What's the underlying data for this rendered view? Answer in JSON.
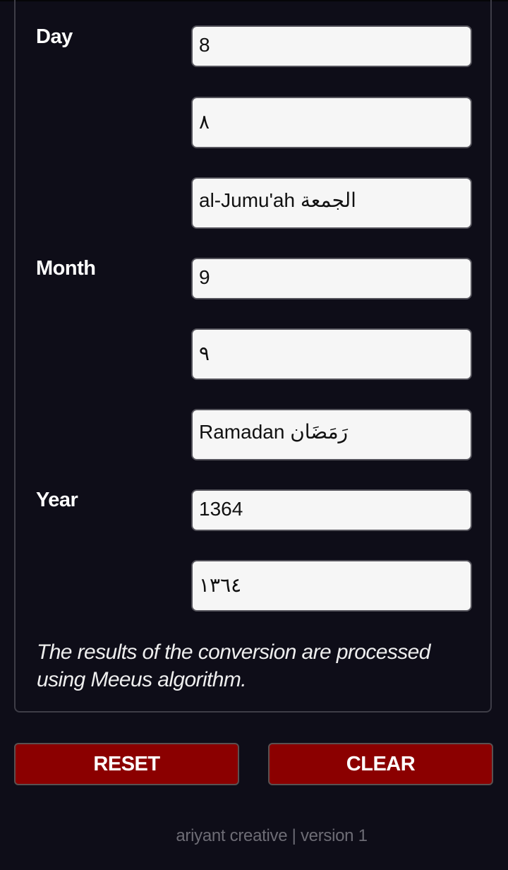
{
  "labels": {
    "day": "Day",
    "month": "Month",
    "year": "Year"
  },
  "fields": {
    "day_latin": "8",
    "day_arabic": "٨",
    "day_name": "al-Jumu'ah الجمعة",
    "month_latin": "9",
    "month_arabic": "٩",
    "month_name": "Ramadan رَمَضَان",
    "year_latin": "1364",
    "year_arabic": "١٣٦٤"
  },
  "note": "The results of the conversion are processed using Meeus algorithm.",
  "buttons": {
    "reset": "RESET",
    "clear": "CLEAR"
  },
  "footer": "ariyant creative | version 1",
  "colors": {
    "background": "#0e0d18",
    "button": "#8b0000",
    "field": "#f6f6f6"
  }
}
